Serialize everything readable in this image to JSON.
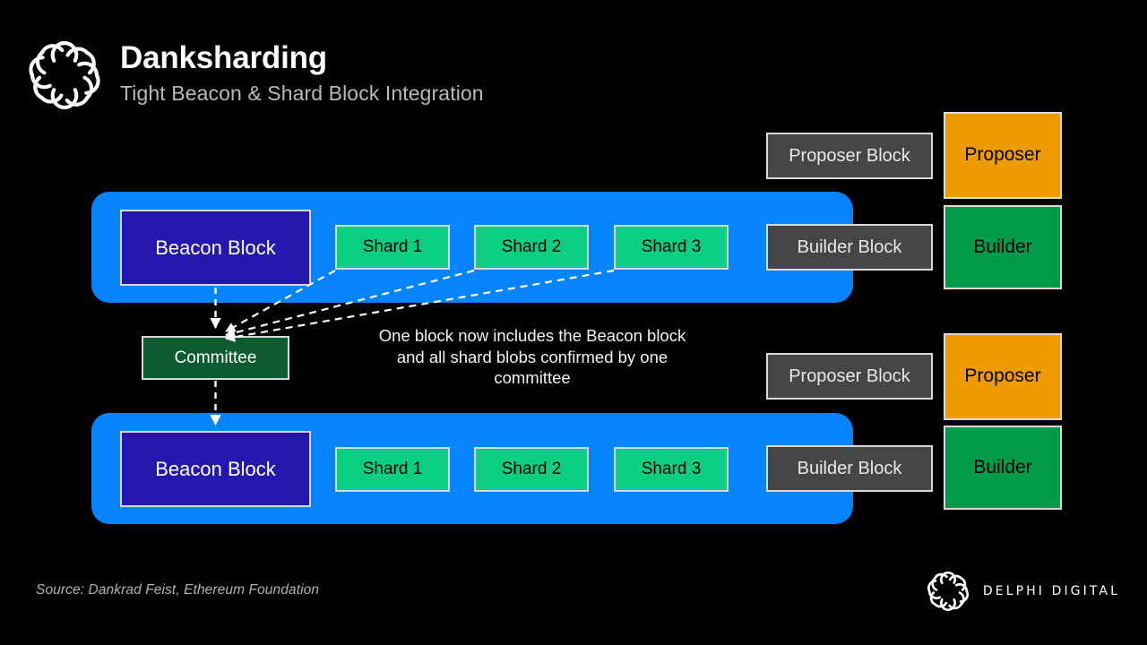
{
  "header": {
    "title": "Danksharding",
    "subtitle": "Tight Beacon & Shard Block Integration",
    "logo_icon": "delphi-knot-logo-icon"
  },
  "diagram": {
    "rows": [
      {
        "id": "row-top",
        "beacon_label": "Beacon Block",
        "shards": [
          "Shard 1",
          "Shard 2",
          "Shard 3"
        ],
        "inner_block_label": "Builder Block",
        "outer_block_label": "Proposer Block",
        "actor_top": "Proposer",
        "actor_bottom": "Builder"
      },
      {
        "id": "row-bottom",
        "beacon_label": "Beacon Block",
        "shards": [
          "Shard 1",
          "Shard 2",
          "Shard 3"
        ],
        "inner_block_label": "Builder Block",
        "outer_block_label": "Proposer Block",
        "actor_top": "Proposer",
        "actor_bottom": "Builder"
      }
    ],
    "committee_label": "Committee",
    "annotation": "One block now includes the Beacon block and all shard blobs confirmed by one committee"
  },
  "footer": {
    "source": "Source: Dankrad Feist, Ethereum Foundation",
    "brand": "DELPHI DIGITAL",
    "logo_icon": "delphi-knot-logo-icon"
  },
  "colors": {
    "background": "#000000",
    "container_blue": "#0584FE",
    "beacon_indigo": "#2418AD",
    "shard_green": "#0ACF83",
    "block_gray": "#464646",
    "proposer_orange": "#EE9B00",
    "builder_green": "#009A4B",
    "committee_green": "#0D5B30",
    "stroke_white": "#d8d8d8"
  }
}
